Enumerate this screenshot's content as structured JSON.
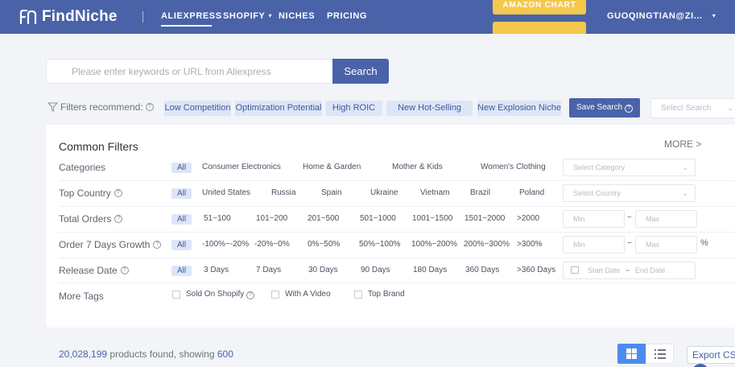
{
  "header": {
    "logo_text": "FindNiche",
    "nav": [
      {
        "label": "ALIEXPRESS",
        "active": true
      },
      {
        "label": "SHOPIFY",
        "has_dropdown": true
      },
      {
        "label": "NICHES"
      },
      {
        "label": "PRICING"
      }
    ],
    "amazon_chart_label": "AMAZON CHART",
    "user_label": "GUOQINGTIAN@ZI...",
    "colors": {
      "bar": "#4a63a8",
      "amazon": "#f5c84c"
    }
  },
  "search": {
    "placeholder": "Please enter keywords or URL from Aliexpress",
    "value": "",
    "button_label": "Search"
  },
  "recommend": {
    "label": "Filters recommend:",
    "chips": [
      "Low Competition",
      "Optimization Potential",
      "High ROIC",
      "New Hot-Selling",
      "New Explosion Niche"
    ],
    "save_search_label": "Save Search",
    "select_search_placeholder": "Select Search"
  },
  "filters": {
    "title": "Common Filters",
    "more_label": "MORE >",
    "all_label": "All",
    "categories": {
      "label": "Categories",
      "options": [
        "Consumer Electronics",
        "Home & Garden",
        "Mother & Kids",
        "Women's Clothing"
      ],
      "select_placeholder": "Select Category"
    },
    "top_country": {
      "label": "Top Country",
      "options": [
        "United States",
        "Russia",
        "Spain",
        "Ukraine",
        "Vietnam",
        "Brazil",
        "Poland"
      ],
      "select_placeholder": "Select Country"
    },
    "total_orders": {
      "label": "Total Orders",
      "options": [
        "51~100",
        "101~200",
        "201~500",
        "501~1000",
        "1001~1500",
        "1501~2000",
        ">2000"
      ],
      "min_placeholder": "Min",
      "max_placeholder": "Max",
      "separator": "~"
    },
    "order_growth": {
      "label": "Order 7 Days Growth",
      "options": [
        "-100%~-20%",
        "-20%~0%",
        "0%~50%",
        "50%~100%",
        "100%~200%",
        "200%~300%",
        ">300%"
      ],
      "min_placeholder": "Min",
      "max_placeholder": "Max",
      "separator": "~",
      "unit": "%"
    },
    "release_date": {
      "label": "Release Date",
      "options": [
        "3 Days",
        "7 Days",
        "30 Days",
        "90 Days",
        "180 Days",
        "360 Days",
        ">360 Days"
      ],
      "start_placeholder": "Start Date",
      "end_placeholder": "End Date",
      "separator": "~"
    },
    "more_tags": {
      "label": "More Tags",
      "options": [
        "Sold On Shopify",
        "With A Video",
        "Top Brand"
      ]
    }
  },
  "results": {
    "count": "20,028,199",
    "middle_text": "products found, showing",
    "showing": "600",
    "export_label": "Export CSV"
  }
}
